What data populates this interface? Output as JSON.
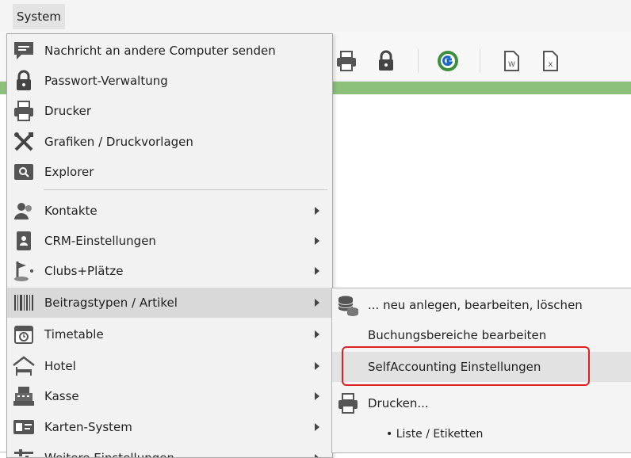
{
  "menubar": {
    "system_label": "System"
  },
  "toolbar": {
    "icons": [
      "printer-icon",
      "lock-icon",
      "google-icon",
      "word-icon",
      "excel-icon"
    ],
    "accent_color": "#8dc07a"
  },
  "menu": {
    "items": [
      {
        "label": "Nachricht an andere Computer senden",
        "icon": "message-icon"
      },
      {
        "label": "Passwort-Verwaltung",
        "icon": "lock-icon"
      },
      {
        "label": "Drucker",
        "icon": "printer-icon"
      },
      {
        "label": "Grafiken / Druckvorlagen",
        "icon": "tools-icon"
      },
      {
        "label": "Explorer",
        "icon": "explorer-icon"
      },
      {
        "label": "Kontakte",
        "icon": "contacts-icon",
        "submenu": true
      },
      {
        "label": "CRM-Einstellungen",
        "icon": "crm-icon",
        "submenu": true
      },
      {
        "label": "Clubs+Plätze",
        "icon": "clubs-icon",
        "submenu": true
      },
      {
        "label": "Beitragstypen / Artikel",
        "icon": "barcode-icon",
        "submenu": true
      },
      {
        "label": "Timetable",
        "icon": "calendar-icon",
        "submenu": true
      },
      {
        "label": "Hotel",
        "icon": "hotel-icon",
        "submenu": true
      },
      {
        "label": "Kasse",
        "icon": "cash-register-icon",
        "submenu": true
      },
      {
        "label": "Karten-System",
        "icon": "card-icon",
        "submenu": true
      },
      {
        "label": "Weitere Einstellungen",
        "icon": "settings-icon",
        "submenu": true
      }
    ]
  },
  "submenu": {
    "items": [
      {
        "label": "... neu anlegen, bearbeiten, löschen",
        "icon": "coins-icon"
      },
      {
        "label": "Buchungsbereiche bearbeiten"
      },
      {
        "label": "SelfAccounting Einstellungen"
      },
      {
        "label": "Drucken...",
        "icon": "printer-icon"
      },
      {
        "label": "• Liste / Etiketten"
      }
    ],
    "highlight_color": "#e02020"
  }
}
